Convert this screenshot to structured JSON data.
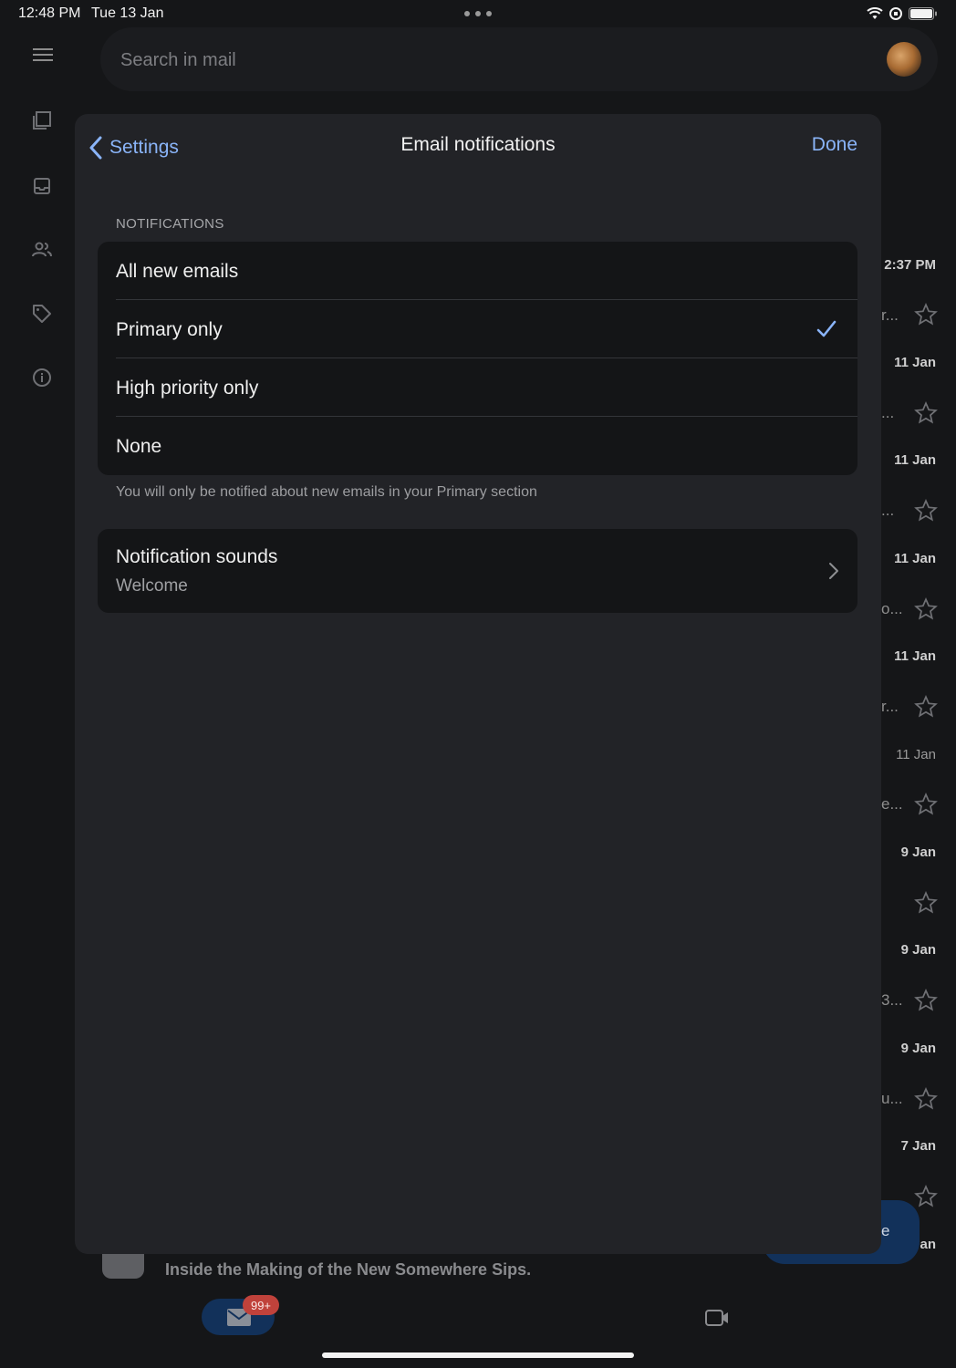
{
  "status_bar": {
    "time": "12:48 PM",
    "date": "Tue 13 Jan"
  },
  "search": {
    "placeholder": "Search in mail"
  },
  "background_list": {
    "dates": [
      "2:37 PM",
      "11 Jan",
      "11 Jan",
      "11 Jan",
      "11 Jan",
      "11 Jan",
      "9 Jan",
      "9 Jan",
      "9 Jan",
      "7 Jan",
      "an"
    ],
    "snippets": [
      "r...",
      "...",
      "...",
      "o...",
      "r...",
      "e...",
      "3...",
      "u..."
    ]
  },
  "bottom_preview": {
    "text": "Inside the Making of the New Somewhere Sips."
  },
  "compose": {
    "label": "e"
  },
  "bottom_nav": {
    "mail_badge": "99+"
  },
  "modal": {
    "back_label": "Settings",
    "title": "Email notifications",
    "done_label": "Done",
    "section_header": "NOTIFICATIONS",
    "options": [
      {
        "label": "All new emails",
        "selected": false
      },
      {
        "label": "Primary only",
        "selected": true
      },
      {
        "label": "High priority only",
        "selected": false
      },
      {
        "label": "None",
        "selected": false
      }
    ],
    "footer_note": "You will only be notified about new emails in your Primary section",
    "notification_sounds": {
      "title": "Notification sounds",
      "value": "Welcome"
    }
  },
  "colors": {
    "accent": "#8ab4f8",
    "background": "#151618",
    "modal": "#222327",
    "group": "#141517"
  }
}
